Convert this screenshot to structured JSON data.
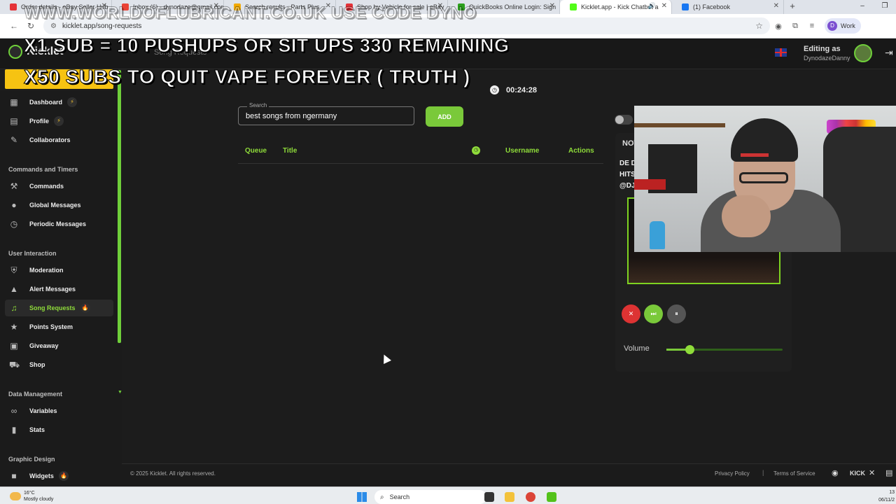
{
  "browser": {
    "tabs": [
      {
        "label": "Order details - eBay Seller Hub",
        "favicon_color": "#e53238"
      },
      {
        "label": "Inbox (6) - dynodaze@gmail.com",
        "favicon_color": "#ea4335"
      },
      {
        "label": "Search results - Parts Plus",
        "favicon_color": "#f2a900"
      },
      {
        "label": "Shop by Vehicle for sale | eBay",
        "favicon_color": "#e53238"
      },
      {
        "label": "QuickBooks Online Login: Sign",
        "favicon_color": "#2ca01c"
      },
      {
        "label": "Kicklet.app - Kick Chatbot a",
        "favicon_color": "#53fc18",
        "active": true
      },
      {
        "label": "(1) Facebook",
        "favicon_color": "#1877f2"
      }
    ],
    "url": "kicklet.app/song-requests",
    "profile_label": "Work",
    "profile_initial": "D"
  },
  "overlays": {
    "line1": "WWW.WORLDOFLUBRICANT.CO.UK USE CODE DYNO",
    "line2": "X1 SUB = 10 PUSHUPS OR SIT UPS 330 REMAINING",
    "line3": "X50 SUBS TO QUIT VAPE FOREVER ( TRUTH )"
  },
  "header": {
    "logo": "Kicklet",
    "breadcrumb": "Song Requests",
    "editing_label": "Editing as",
    "username": "DynodazeDanny",
    "language_icon": "uk-flag-icon"
  },
  "sidebar": {
    "top_items": [
      {
        "label": "Dashboard",
        "icon": "dashboard-icon",
        "badge": "⚡"
      },
      {
        "label": "Profile",
        "icon": "profile-icon",
        "badge": "⚡"
      },
      {
        "label": "Collaborators",
        "icon": "collaborators-icon"
      }
    ],
    "section_commands": "Commands and Timers",
    "commands_items": [
      {
        "label": "Commands",
        "icon": "hammer-icon"
      },
      {
        "label": "Global Messages",
        "icon": "chat-icon"
      },
      {
        "label": "Periodic Messages",
        "icon": "clock-icon"
      }
    ],
    "section_interaction": "User Interaction",
    "interaction_items": [
      {
        "label": "Moderation",
        "icon": "shield-icon"
      },
      {
        "label": "Alert Messages",
        "icon": "warning-icon"
      },
      {
        "label": "Song Requests",
        "icon": "music-icon",
        "badge": "🔥",
        "active": true
      },
      {
        "label": "Points System",
        "icon": "star-icon"
      },
      {
        "label": "Giveaway",
        "icon": "gift-icon"
      },
      {
        "label": "Shop",
        "icon": "cart-icon"
      }
    ],
    "section_data": "Data Management",
    "data_items": [
      {
        "label": "Variables",
        "icon": "link-icon"
      },
      {
        "label": "Stats",
        "icon": "chart-icon"
      }
    ],
    "section_graphic": "Graphic Design",
    "graphic_items": [
      {
        "label": "Widgets",
        "icon": "video-icon",
        "badge": "🔥"
      }
    ]
  },
  "main": {
    "timer": "00:24:28",
    "search_label": "Search",
    "search_value": "best songs from ngermany",
    "add_label": "ADD",
    "columns": {
      "queue": "Queue",
      "title": "Title",
      "username": "Username",
      "actions": "Actions"
    }
  },
  "now_playing": {
    "title": "NOW PLAYING",
    "song_line1": "DE D",
    "song_line2": "HITS",
    "song_line3": "@DJ",
    "volume_label": "Volume",
    "volume_level": 0.2
  },
  "footer": {
    "copyright": "© 2025 Kicklet. All rights reserved.",
    "privacy": "Privacy Policy",
    "separator": "|",
    "terms": "Terms of Service"
  },
  "taskbar": {
    "temperature": "16°C",
    "weather": "Mostly cloudy",
    "search": "Search",
    "time": "13",
    "date": "06/11/2"
  },
  "colors": {
    "accent": "#7ac93a",
    "background": "#1c1c1c",
    "stop": "#d33333"
  }
}
